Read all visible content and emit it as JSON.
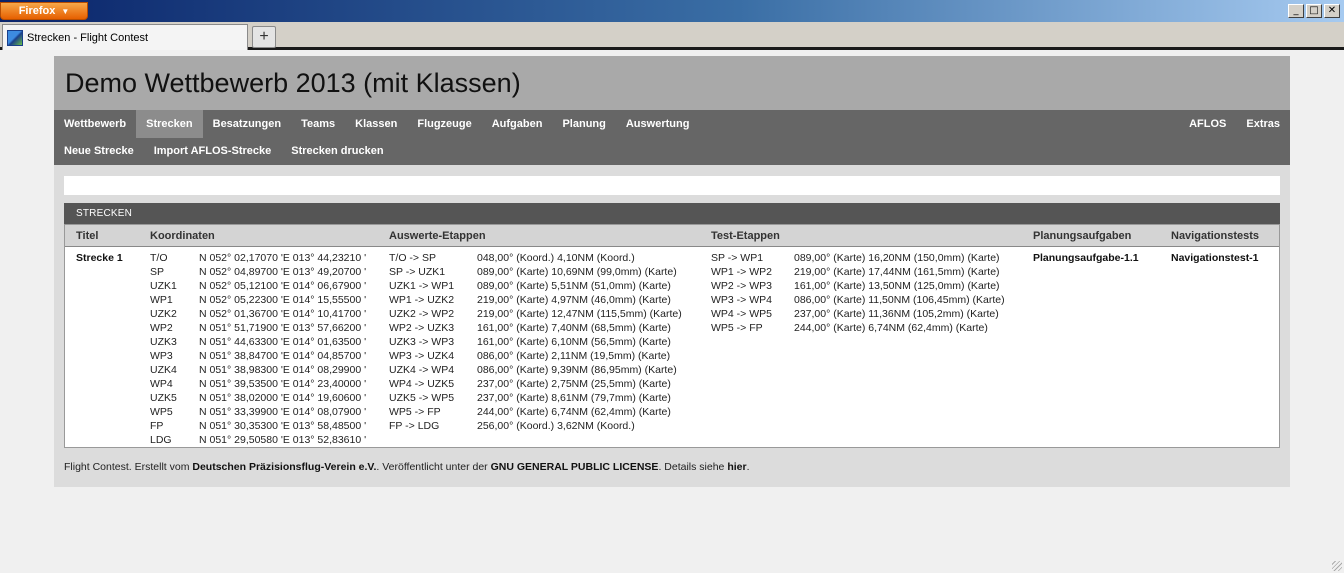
{
  "browser": {
    "menu_button": "Firefox",
    "tab_title": "Strecken - Flight Contest",
    "new_tab": "+",
    "win_minimize": "_",
    "win_maximize": "□",
    "win_close": "✕"
  },
  "page": {
    "title": "Demo Wettbewerb 2013 (mit Klassen)"
  },
  "nav": {
    "main": [
      "Wettbewerb",
      "Strecken",
      "Besatzungen",
      "Teams",
      "Klassen",
      "Flugzeuge",
      "Aufgaben",
      "Planung",
      "Auswertung"
    ],
    "right": [
      "AFLOS",
      "Extras"
    ],
    "sub": [
      "Neue Strecke",
      "Import AFLOS-Strecke",
      "Strecken drucken"
    ],
    "active": "Strecken"
  },
  "section": {
    "heading": "STRECKEN"
  },
  "table": {
    "headers": {
      "titel": "Titel",
      "koordinaten": "Koordinaten",
      "auswerte": "Auswerte-Etappen",
      "test": "Test-Etappen",
      "planung": "Planungsaufgaben",
      "navigation": "Navigationstests"
    },
    "row": {
      "titel": "Strecke 1",
      "points": [
        "T/O",
        "SP",
        "UZK1",
        "WP1",
        "UZK2",
        "WP2",
        "UZK3",
        "WP3",
        "UZK4",
        "WP4",
        "UZK5",
        "WP5",
        "FP",
        "LDG"
      ],
      "coords": [
        "N 052° 02,17070 'E 013° 44,23210 '",
        "N 052° 04,89700 'E 013° 49,20700 '",
        "N 052° 05,12100 'E 014° 06,67900 '",
        "N 052° 05,22300 'E 014° 15,55500 '",
        "N 052° 01,36700 'E 014° 10,41700 '",
        "N 051° 51,71900 'E 013° 57,66200 '",
        "N 051° 44,63300 'E 014° 01,63500 '",
        "N 051° 38,84700 'E 014° 04,85700 '",
        "N 051° 38,98300 'E 014° 08,29900 '",
        "N 051° 39,53500 'E 014° 23,40000 '",
        "N 051° 38,02000 'E 014° 19,60600 '",
        "N 051° 33,39900 'E 014° 08,07900 '",
        "N 051° 30,35300 'E 013° 58,48500 '",
        "N 051° 29,50580 'E 013° 52,83610 '"
      ],
      "auswerte_legs": [
        "T/O -> SP",
        "SP -> UZK1",
        "UZK1 -> WP1",
        "WP1 -> UZK2",
        "UZK2 -> WP2",
        "WP2 -> UZK3",
        "UZK3 -> WP3",
        "WP3 -> UZK4",
        "UZK4 -> WP4",
        "WP4 -> UZK5",
        "UZK5 -> WP5",
        "WP5 -> FP",
        "FP -> LDG"
      ],
      "auswerte_values": [
        "048,00° (Koord.) 4,10NM (Koord.)",
        "089,00° (Karte) 10,69NM (99,0mm) (Karte)",
        "089,00° (Karte) 5,51NM (51,0mm) (Karte)",
        "219,00° (Karte) 4,97NM (46,0mm) (Karte)",
        "219,00° (Karte) 12,47NM (115,5mm) (Karte)",
        "161,00° (Karte) 7,40NM (68,5mm) (Karte)",
        "161,00° (Karte) 6,10NM (56,5mm) (Karte)",
        "086,00° (Karte) 2,11NM (19,5mm) (Karte)",
        "086,00° (Karte) 9,39NM (86,95mm) (Karte)",
        "237,00° (Karte) 2,75NM (25,5mm) (Karte)",
        "237,00° (Karte) 8,61NM (79,7mm) (Karte)",
        "244,00° (Karte) 6,74NM (62,4mm) (Karte)",
        "256,00° (Koord.) 3,62NM (Koord.)"
      ],
      "test_legs": [
        "SP -> WP1",
        "WP1 -> WP2",
        "WP2 -> WP3",
        "WP3 -> WP4",
        "WP4 -> WP5",
        "WP5 -> FP"
      ],
      "test_values": [
        "089,00° (Karte) 16,20NM (150,0mm) (Karte)",
        "219,00° (Karte) 17,44NM (161,5mm) (Karte)",
        "161,00° (Karte) 13,50NM (125,0mm) (Karte)",
        "086,00° (Karte) 11,50NM (106,45mm) (Karte)",
        "237,00° (Karte) 11,36NM (105,2mm) (Karte)",
        "244,00° (Karte) 6,74NM (62,4mm) (Karte)"
      ],
      "planungsaufgabe": "Planungsaufgabe-1.1",
      "navigationstest": "Navigationstest-1"
    }
  },
  "footer": {
    "prefix": "Flight Contest. Erstellt vom ",
    "org": "Deutschen Präzisionsflug-Verein e.V.",
    "mid": ". Veröffentlicht unter der ",
    "license": "GNU GENERAL PUBLIC LICENSE",
    "suffix1": ". Details siehe ",
    "link": "hier",
    "suffix2": "."
  }
}
